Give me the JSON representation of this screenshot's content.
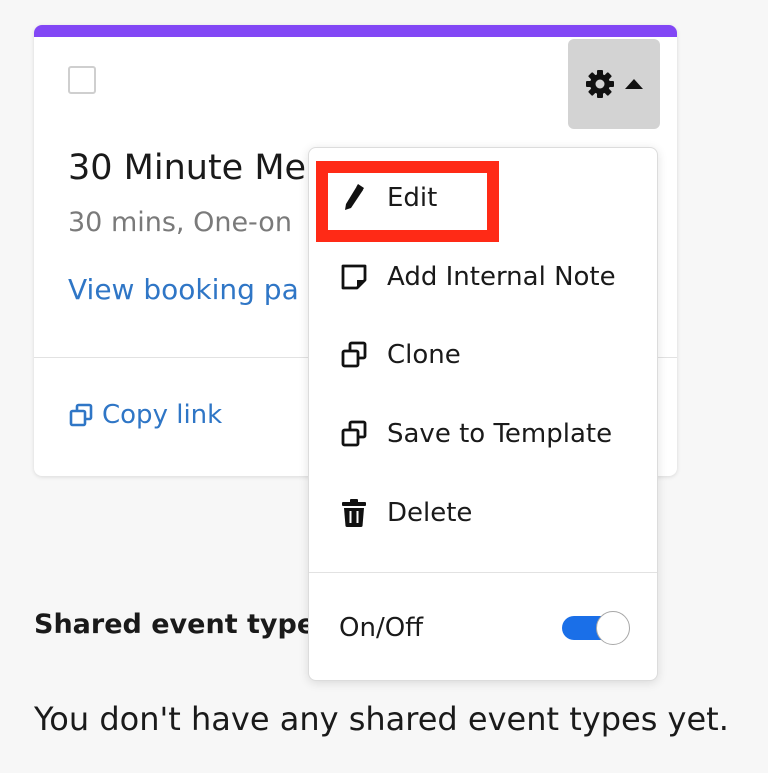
{
  "card": {
    "accent_color": "#8247f5",
    "title": "30 Minute Me",
    "subtitle": "30 mins, One-on",
    "link_label": "View booking pa",
    "copy_link_label": "Copy link",
    "gear_icon": "gear-icon",
    "caret_icon": "caret-up-icon"
  },
  "menu": {
    "items": [
      {
        "icon": "pencil-icon",
        "label": "Edit"
      },
      {
        "icon": "note-icon",
        "label": "Add Internal Note"
      },
      {
        "icon": "clone-icon",
        "label": "Clone"
      },
      {
        "icon": "template-icon",
        "label": "Save to Template"
      },
      {
        "icon": "trash-icon",
        "label": "Delete"
      }
    ],
    "toggle_label": "On/Off",
    "toggle_on": true,
    "toggle_color": "#1a6fe8"
  },
  "highlight_color": "#ff2a16",
  "shared": {
    "heading": "Shared event type",
    "empty_text": "You don't have any shared event types yet."
  }
}
